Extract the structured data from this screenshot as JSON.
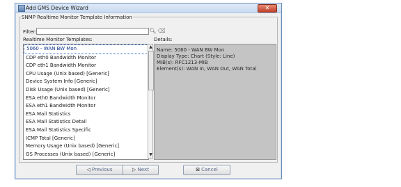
{
  "window": {
    "title": "Add GMS Device Wizard",
    "close_glyph": "✕"
  },
  "group": {
    "title": "SNMP Realtime Monitor Template Information"
  },
  "filter": {
    "label": "Filter:",
    "value": ""
  },
  "templates": {
    "label": "Realtime Monitor Templates:",
    "items": [
      "5060 - WAN BW Mon",
      "CDP eth0 Bandwidth Monitor",
      "CDP eth1 Bandwidth Monitor",
      "CPU Usage (Unix based) [Generic]",
      "Device System Info [Generic]",
      "Disk Usage (Unix based) [Generic]",
      "ESA eth0 Bandwidth Monitor",
      "ESA eth1 Bandwidth Monitor",
      "ESA Mail Statistics",
      "ESA Mail Statistics Detail",
      "ESA Mail Statistics Specific",
      "ICMP Total [Generic]",
      "Memory Usage (Unix based) [Generic]",
      "OS Processes (Unix based) [Generic]"
    ],
    "selected_index": 0
  },
  "details": {
    "label": "Details:",
    "lines": [
      "Name: 5060 - WAN BW Mon",
      "Display Type: Chart  (Style: Line)",
      "MIB(s): RFC1213-MIB",
      "Element(s): WAN In, WAN Out, WAN Total"
    ]
  },
  "buttons": {
    "previous": "Previous",
    "next": "Next",
    "cancel": "Cancel"
  },
  "icons": {
    "search": "binoculars-icon",
    "clear": "eraser-icon",
    "previous": "arrow-left-icon",
    "next": "arrow-right-icon",
    "cancel": "cancel-x-icon"
  },
  "colors": {
    "selection_border": "#1f5fbf",
    "details_bg": "#c4c4c4",
    "close_button": "#c3402a"
  }
}
